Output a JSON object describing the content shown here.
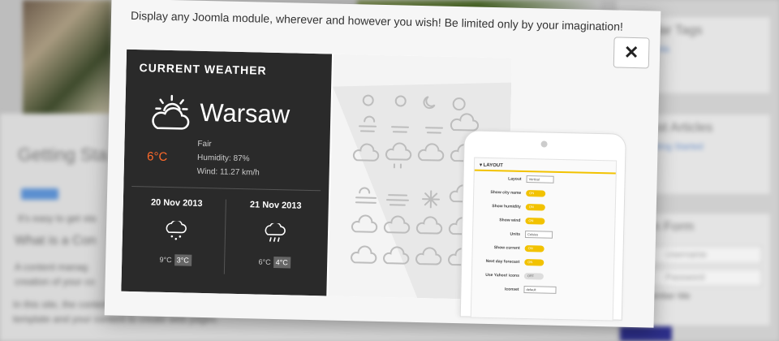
{
  "background": {
    "article_title": "Getting Sta",
    "article_tag": "",
    "article_intro": "It's easy to get sta",
    "article_heading": "What is a Con",
    "article_text_1": "A content manag",
    "article_text_2": "creation of your co",
    "article_text_3": "In this site, the content is stored in a database. The look and feel are created by a template. Joomla! brings together the",
    "article_text_4": "template and your content to create web pages.",
    "sidebar_box_1_title": "ular Tags",
    "sidebar_box_1_link": "omla",
    "sidebar_box_2_title": "est Articles",
    "sidebar_box_2_link": "etting Started",
    "sidebar_box_3_title": "in Form",
    "username_placeholder": "Username",
    "password_placeholder": "Password",
    "remember_label": "ember Me"
  },
  "modal": {
    "heading": "Display any Joomla module, wherever and however you wish! Be limited only by your imagination!",
    "close_label": "✕"
  },
  "weather": {
    "title": "CURRENT WEATHER",
    "city": "Warsaw",
    "temperature": "6°C",
    "condition": "Fair",
    "humidity": "Humidity: 87%",
    "wind": "Wind: 11.27 km/h",
    "forecast": [
      {
        "date": "20 Nov 2013",
        "high": "9°C",
        "low": "3°C"
      },
      {
        "date": "21 Nov 2013",
        "high": "6°C",
        "low": "4°C"
      }
    ]
  },
  "layout_panel": {
    "title": "LAYOUT",
    "rows": [
      {
        "label": "Layout",
        "type": "select",
        "value": "Vertical"
      },
      {
        "label": "Show city name",
        "type": "toggle",
        "value": "ON"
      },
      {
        "label": "Show humidity",
        "type": "toggle",
        "value": "ON"
      },
      {
        "label": "Show wind",
        "type": "toggle",
        "value": "ON"
      },
      {
        "label": "Units",
        "type": "select",
        "value": "Celsius"
      },
      {
        "label": "Show current",
        "type": "toggle",
        "value": "ON"
      },
      {
        "label": "Next day forecast",
        "type": "toggle",
        "value": "ON"
      },
      {
        "label": "Use Yahoo! icons",
        "type": "toggle",
        "value": "OFF"
      },
      {
        "label": "Iconset",
        "type": "select",
        "value": "default"
      }
    ]
  },
  "colors": {
    "accent": "#f2c200",
    "temp": "#ff6a2a",
    "panel": "#2a2a2a"
  }
}
